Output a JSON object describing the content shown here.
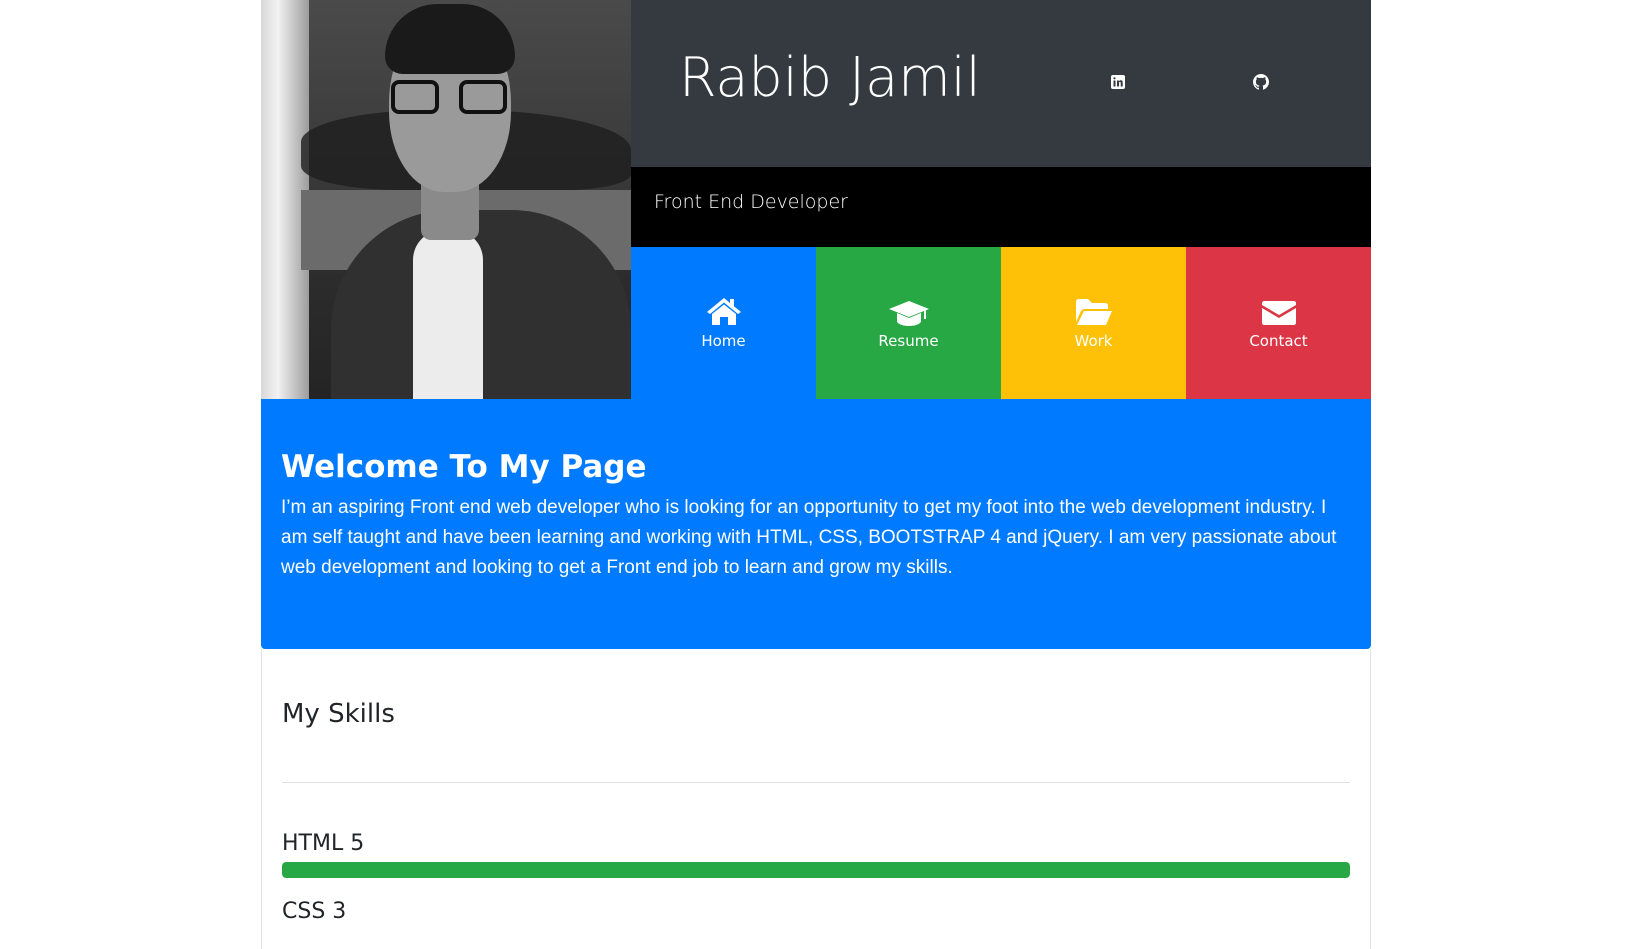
{
  "header": {
    "name": "Rabib Jamil",
    "subtitle": "Front End Developer",
    "social": [
      {
        "icon": "linkedin-icon"
      },
      {
        "icon": "github-icon"
      }
    ]
  },
  "nav": {
    "items": [
      {
        "label": "Home",
        "icon": "home-icon",
        "color": "#007bff"
      },
      {
        "label": "Resume",
        "icon": "graduation-cap-icon",
        "color": "#28a745"
      },
      {
        "label": "Work",
        "icon": "folder-open-icon",
        "color": "#ffc107"
      },
      {
        "label": "Contact",
        "icon": "envelope-icon",
        "color": "#dc3545"
      }
    ]
  },
  "welcome": {
    "heading": "Welcome To My Page",
    "body": "I’m an aspiring Front end web developer who is looking for an opportunity to get my foot into the web development industry. I am self taught and have been learning and working with HTML, CSS, BOOTSTRAP 4 and jQuery. I am very passionate about web development and looking to get a Front end job to learn and grow my skills."
  },
  "skills": {
    "heading": "My Skills",
    "items": [
      {
        "label": "HTML 5",
        "progress": 100,
        "color": "#28a745"
      },
      {
        "label": "CSS 3"
      }
    ]
  },
  "colors": {
    "dark": "#343a40",
    "primary": "#007bff",
    "success": "#28a745",
    "warning": "#ffc107",
    "danger": "#dc3545"
  }
}
